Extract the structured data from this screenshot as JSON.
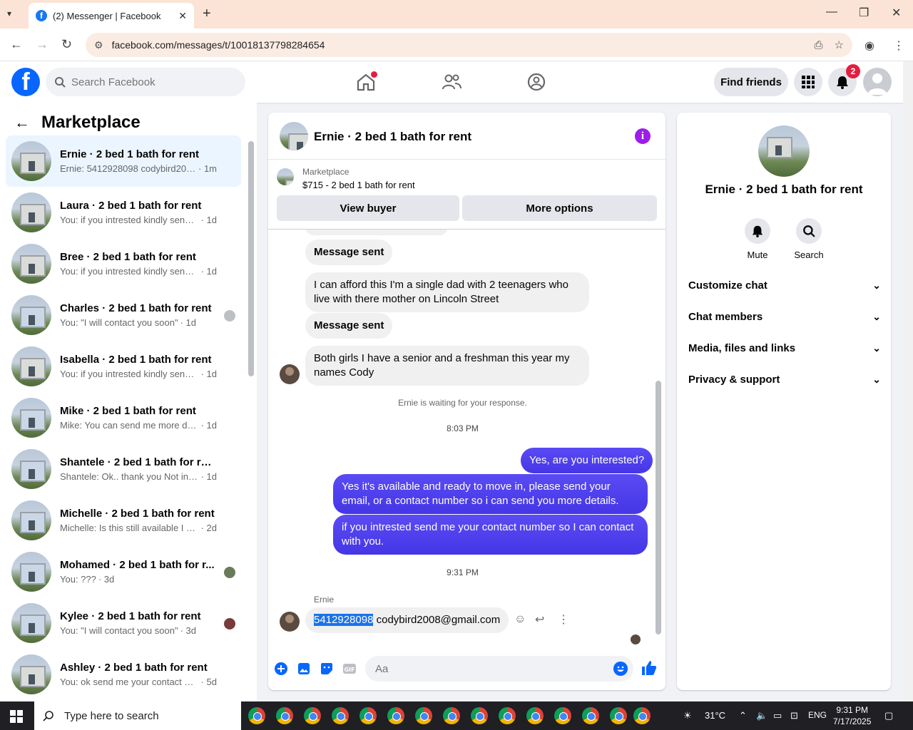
{
  "browser": {
    "tab_title": "(2) Messenger | Facebook",
    "url": "facebook.com/messages/t/10018137798284654"
  },
  "fb": {
    "search_placeholder": "Search Facebook",
    "find_friends": "Find friends",
    "notification_count": "2"
  },
  "sidebar": {
    "title": "Marketplace",
    "chats": [
      {
        "name": "Ernie · 2 bed 1 bath for rent",
        "preview": "Ernie: 5412928098 codybird2008...",
        "time": "· 1m"
      },
      {
        "name": "Laura · 2 bed 1 bath for rent",
        "preview": "You: if you intrested kindly send m...",
        "time": "· 1d"
      },
      {
        "name": "Bree · 2 bed 1 bath for rent",
        "preview": "You: if you intrested kindly send m...",
        "time": "· 1d"
      },
      {
        "name": "Charles · 2 bed 1 bath for rent",
        "preview": "You: \"I will contact you soon\"",
        "time": "· 1d"
      },
      {
        "name": "Isabella · 2 bed 1 bath for rent",
        "preview": "You: if you intrested kindly send m...",
        "time": "· 1d"
      },
      {
        "name": "Mike · 2 bed 1 bath for rent",
        "preview": "Mike: You can send me more detail...",
        "time": "· 1d"
      },
      {
        "name": "Shantele · 2 bed 1 bath for rent",
        "preview": "Shantele: Ok.. thank you Not intere...",
        "time": "· 1d"
      },
      {
        "name": "Michelle · 2 bed 1 bath for rent",
        "preview": "Michelle: Is this still available I am v...",
        "time": "· 2d"
      },
      {
        "name": "Mohamed · 2 bed 1 bath for r...",
        "preview": "You: ???",
        "time": "· 3d"
      },
      {
        "name": "Kylee · 2 bed 1 bath for rent",
        "preview": "You: \"I will contact you soon\"",
        "time": "· 3d"
      },
      {
        "name": "Ashley · 2 bed 1 bath for rent",
        "preview": "You: ok send me your contact num...",
        "time": "· 5d"
      }
    ]
  },
  "conversation": {
    "title": "Ernie · 2 bed 1 bath for rent",
    "marketplace_label": "Marketplace",
    "listing": "$715 - 2 bed 1 bath for rent",
    "view_buyer": "View buyer",
    "more_options": "More options",
    "messages": {
      "m1": "Message sent",
      "m2": "I can afford this I'm a single dad with 2 teenagers who live with there mother on Lincoln Street",
      "m3": "Message sent",
      "m4": "Both girls I have a senior and a freshman this year my names Cody",
      "waiting": "Ernie is waiting for your response.",
      "ts1": "8:03 PM",
      "o1": "Yes, are you interested?",
      "o2": "Yes it's available and ready to move in, please send your email, or a contact number so i can send you more details.",
      "o3": "if you intrested send me your contact number so I can contact with you.",
      "ts2": "9:31 PM",
      "sender": "Ernie",
      "last_selected": "5412928098",
      "last_rest": " codybird2008@gmail.com"
    },
    "composer_placeholder": "Aa"
  },
  "info_panel": {
    "name": "Ernie · 2 bed 1 bath for rent",
    "mute": "Mute",
    "search": "Search",
    "sections": [
      "Customize chat",
      "Chat members",
      "Media, files and links",
      "Privacy & support"
    ]
  },
  "taskbar": {
    "search_placeholder": "Type here to search",
    "temp": "31°C",
    "lang": "ENG",
    "time": "9:31 PM",
    "date": "7/17/2025"
  }
}
